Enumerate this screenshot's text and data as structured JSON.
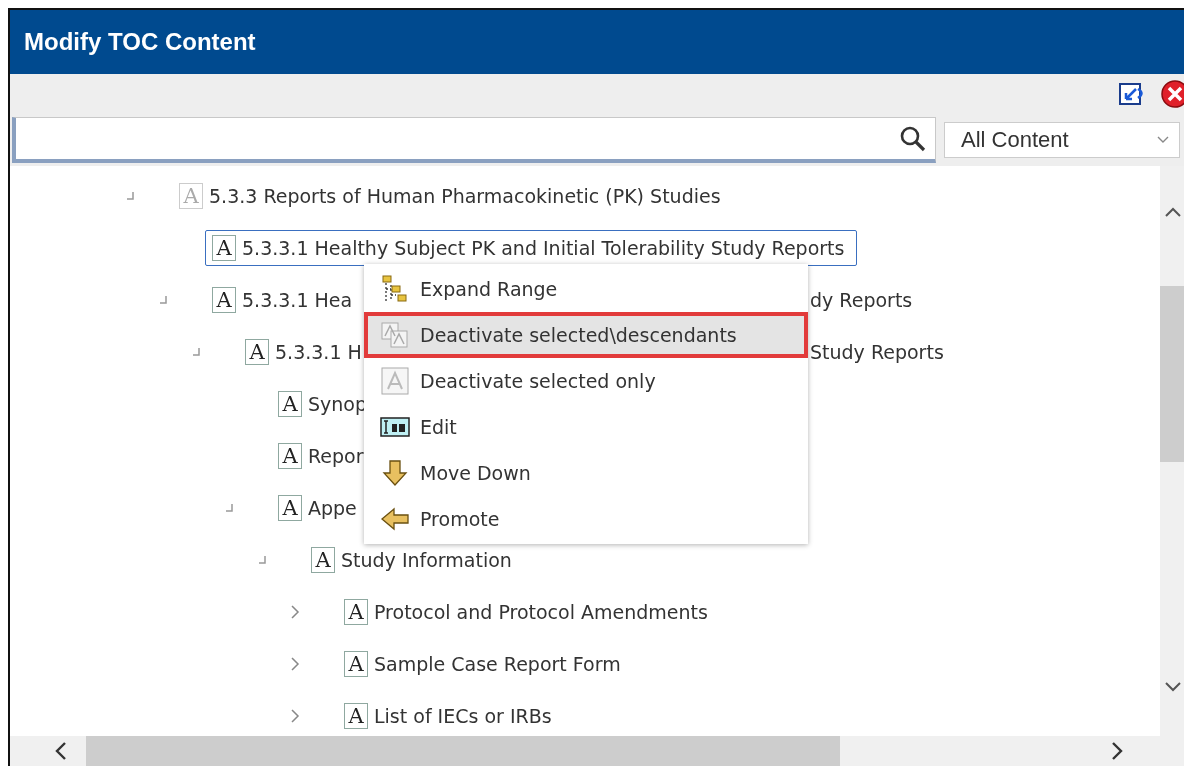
{
  "window": {
    "title": "Modify TOC Content"
  },
  "search": {
    "filter": "All Content"
  },
  "tree": {
    "items": [
      {
        "kind": "branch",
        "icon_letter": "A",
        "active": false,
        "selected": false,
        "expanded": true,
        "label": "5.3.3 Reports of Human Pharmacokinetic (PK) Studies",
        "children": [
          {
            "kind": "leaf",
            "icon_letter": "A",
            "active": true,
            "selected": true,
            "label": "5.3.3.1 Healthy Subject PK and Initial Tolerability Study Reports"
          },
          {
            "kind": "branch",
            "icon_letter": "A",
            "active": true,
            "selected": false,
            "expanded": true,
            "label": "5.3.3.1 Hea",
            "label_tail": "dy Reports",
            "children": [
              {
                "kind": "branch",
                "icon_letter": "A",
                "active": true,
                "selected": false,
                "expanded": true,
                "label": "5.3.3.1 H",
                "label_tail": "Study Reports",
                "children": [
                  {
                    "kind": "leaf",
                    "icon_letter": "A",
                    "active": true,
                    "selected": false,
                    "label": "Synop"
                  },
                  {
                    "kind": "leaf",
                    "icon_letter": "A",
                    "active": true,
                    "selected": false,
                    "label": "Repor"
                  },
                  {
                    "kind": "branch",
                    "icon_letter": "A",
                    "active": true,
                    "selected": false,
                    "expanded": true,
                    "label": "Appe",
                    "children": [
                      {
                        "kind": "branch",
                        "icon_letter": "A",
                        "active": true,
                        "selected": false,
                        "expanded": true,
                        "label": "Study Information",
                        "children": [
                          {
                            "kind": "branch",
                            "icon_letter": "A",
                            "active": true,
                            "selected": false,
                            "expanded": false,
                            "label": "Protocol and Protocol Amendments"
                          },
                          {
                            "kind": "branch",
                            "icon_letter": "A",
                            "active": true,
                            "selected": false,
                            "expanded": false,
                            "label": "Sample Case Report Form"
                          },
                          {
                            "kind": "branch",
                            "icon_letter": "A",
                            "active": true,
                            "selected": false,
                            "expanded": false,
                            "label": "List of IECs or IRBs"
                          }
                        ]
                      }
                    ]
                  }
                ]
              }
            ]
          }
        ]
      }
    ]
  },
  "context_menu": {
    "items": [
      {
        "kind": "expand",
        "label": "Expand Range",
        "highlighted": false
      },
      {
        "kind": "deactivate_all",
        "label": "Deactivate selected\\descendants",
        "highlighted": true
      },
      {
        "kind": "deactivate_one",
        "label": "Deactivate selected only",
        "highlighted": false
      },
      {
        "kind": "edit",
        "label": "Edit",
        "highlighted": false
      },
      {
        "kind": "move_down",
        "label": "Move Down",
        "highlighted": false
      },
      {
        "kind": "promote",
        "label": "Promote",
        "highlighted": false
      }
    ]
  }
}
